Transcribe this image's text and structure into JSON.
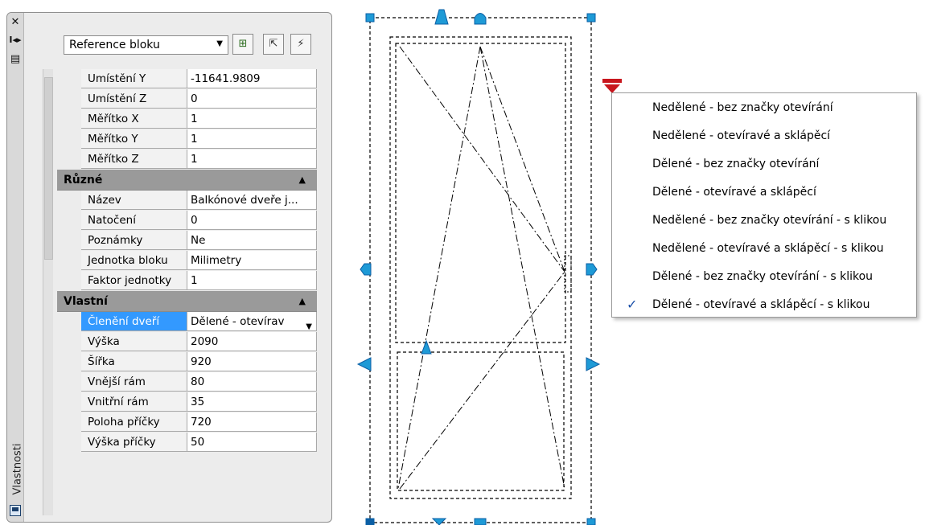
{
  "palette": {
    "title": "Vlastnosti",
    "object_type": "Reference bloku",
    "rows_top": [
      {
        "name": "Umístění Y",
        "value": "-11641.9809"
      },
      {
        "name": "Umístění Z",
        "value": "0"
      },
      {
        "name": "Měřítko X",
        "value": "1"
      },
      {
        "name": "Měřítko Y",
        "value": "1"
      },
      {
        "name": "Měřítko Z",
        "value": "1"
      }
    ],
    "cat_misc": "Různé",
    "rows_misc": [
      {
        "name": "Název",
        "value": "Balkónové dveře j..."
      },
      {
        "name": "Natočení",
        "value": "0"
      },
      {
        "name": "Poznámky",
        "value": "Ne"
      },
      {
        "name": "Jednotka bloku",
        "value": "Milimetry"
      },
      {
        "name": "Faktor jednotky",
        "value": "1"
      }
    ],
    "cat_custom": "Vlastní",
    "rows_custom": [
      {
        "name": "Členění dveří",
        "value": "Dělené - otevírav"
      },
      {
        "name": "Výška",
        "value": "2090"
      },
      {
        "name": "Šířka",
        "value": "920"
      },
      {
        "name": "Vnější rám",
        "value": "80"
      },
      {
        "name": "Vnitřní rám",
        "value": "35"
      },
      {
        "name": "Poloha příčky",
        "value": "720"
      },
      {
        "name": "Výška příčky",
        "value": "50"
      }
    ]
  },
  "menu": {
    "items": [
      {
        "label": "Nedělené - bez značky otevírání",
        "checked": false
      },
      {
        "label": "Nedělené - otevíravé a sklápěcí",
        "checked": false
      },
      {
        "label": "Dělené - bez značky otevírání",
        "checked": false
      },
      {
        "label": "Dělené - otevíravé a sklápěcí",
        "checked": false
      },
      {
        "label": "Nedělené - bez značky otevírání - s klikou",
        "checked": false
      },
      {
        "label": "Nedělené - otevíravé a sklápěcí - s klikou",
        "checked": false
      },
      {
        "label": "Dělené - bez značky otevírání - s klikou",
        "checked": false
      },
      {
        "label": "Dělené - otevíravé a sklápěcí - s klikou",
        "checked": true
      }
    ],
    "check_glyph": "✓"
  },
  "colors": {
    "grip_blue": "#1e9ad6",
    "grip_dark": "#0b5fa5",
    "trigger_red": "#c8161d",
    "selection": "#3399ff"
  }
}
